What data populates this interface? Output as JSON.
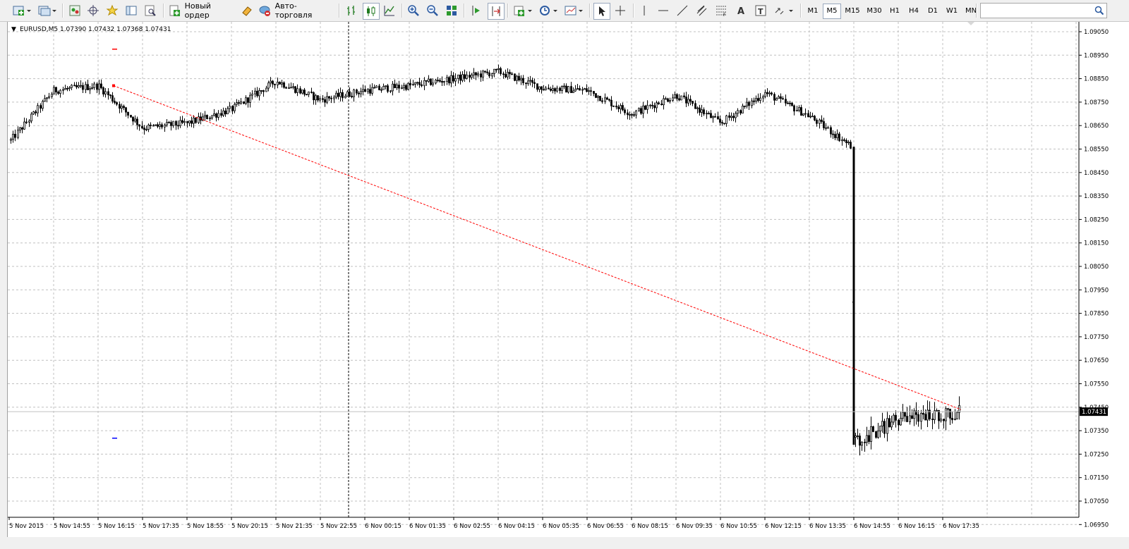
{
  "toolbar": {
    "new_order_label": "Новый ордер",
    "auto_trading_label": "Авто-торговля",
    "timeframes": [
      "M1",
      "M5",
      "M15",
      "M30",
      "H1",
      "H4",
      "D1",
      "W1",
      "MN"
    ],
    "active_timeframe": "M5",
    "search_placeholder": ""
  },
  "chart": {
    "header": "EURUSD,M5  1.07390 1.07432 1.07368 1.07431",
    "current_price_label": "1.07431",
    "y_ticks": [
      "1.09050",
      "1.08950",
      "1.08850",
      "1.08750",
      "1.08650",
      "1.08550",
      "1.08450",
      "1.08350",
      "1.08250",
      "1.08150",
      "1.08050",
      "1.07950",
      "1.07850",
      "1.07750",
      "1.07650",
      "1.07550",
      "1.07450",
      "1.07350",
      "1.07250",
      "1.07150",
      "1.07050",
      "1.06950"
    ],
    "x_ticks": [
      "5 Nov 2015",
      "5 Nov 14:55",
      "5 Nov 16:15",
      "5 Nov 17:35",
      "5 Nov 18:55",
      "5 Nov 20:15",
      "5 Nov 21:35",
      "5 Nov 22:55",
      "6 Nov 00:15",
      "6 Nov 01:35",
      "6 Nov 02:55",
      "6 Nov 04:15",
      "6 Nov 05:35",
      "6 Nov 06:55",
      "6 Nov 08:15",
      "6 Nov 09:35",
      "6 Nov 10:55",
      "6 Nov 12:15",
      "6 Nov 13:35",
      "6 Nov 14:55",
      "6 Nov 16:15",
      "6 Nov 17:35"
    ],
    "colors": {
      "trendline": "#ff0000",
      "price_line": "#c0c0c0",
      "grid": "#c0c0c0",
      "candle": "#000000",
      "current_price_bg": "#000000"
    }
  },
  "chart_data": {
    "type": "candlestick",
    "symbol": "EURUSD",
    "timeframe": "M5",
    "last_bar": {
      "open": 1.0739,
      "high": 1.07432,
      "low": 1.07368,
      "close": 1.07431
    },
    "ylim": [
      1.0695,
      1.0905
    ],
    "x_start": "5 Nov 2015",
    "x_end": "6 Nov 17:35",
    "close_points": [
      [
        "5 Nov 2015",
        1.0858
      ],
      [
        "5 Nov 14:55",
        1.088
      ],
      [
        "5 Nov 16:15",
        1.0882
      ],
      [
        "5 Nov 17:35",
        1.0864
      ],
      [
        "5 Nov 18:55",
        1.0866
      ],
      [
        "5 Nov 20:15",
        1.0872
      ],
      [
        "5 Nov 21:35",
        1.0884
      ],
      [
        "5 Nov 22:55",
        1.0876
      ],
      [
        "6 Nov 00:15",
        1.088
      ],
      [
        "6 Nov 01:35",
        1.0882
      ],
      [
        "6 Nov 02:55",
        1.0885
      ],
      [
        "6 Nov 04:15",
        1.0888
      ],
      [
        "6 Nov 05:35",
        1.0881
      ],
      [
        "6 Nov 06:55",
        1.088
      ],
      [
        "6 Nov 08:15",
        1.087
      ],
      [
        "6 Nov 09:35",
        1.0878
      ],
      [
        "6 Nov 10:55",
        1.0866
      ],
      [
        "6 Nov 12:15",
        1.0879
      ],
      [
        "6 Nov 13:35",
        1.0869
      ],
      [
        "6 Nov 14:55",
        1.073
      ],
      [
        "6 Nov 16:15",
        1.074
      ],
      [
        "6 Nov 17:35",
        1.07431
      ]
    ],
    "low_min": 1.0706,
    "high_max": 1.0896,
    "trendline": {
      "from": [
        "5 Nov 16:15",
        1.0882
      ],
      "to": [
        "6 Nov 17:35",
        1.0744
      ]
    },
    "vertical_line_at": "5 Nov 22:55",
    "current_price": 1.07431,
    "grid": true
  }
}
